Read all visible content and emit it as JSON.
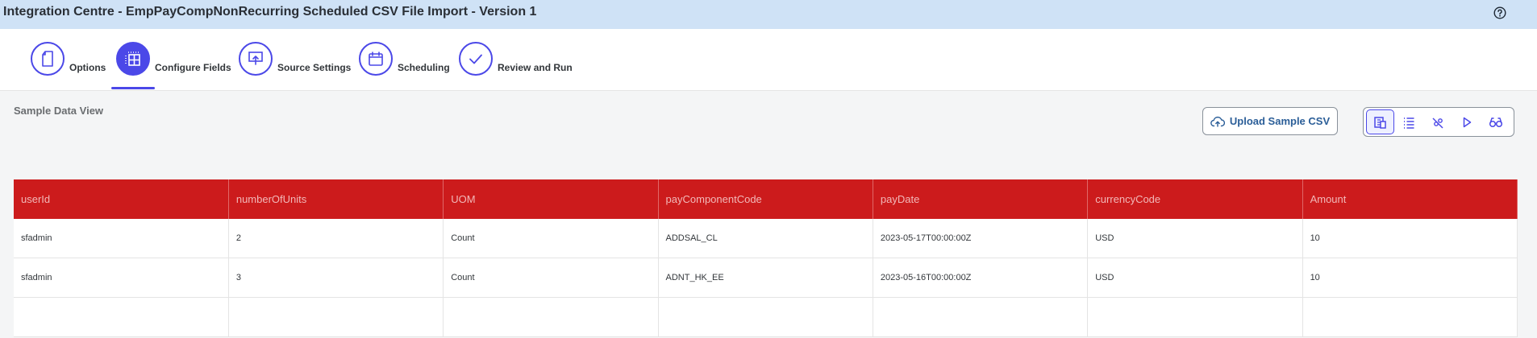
{
  "window": {
    "title": "Integration Centre - EmpPayCompNonRecurring Scheduled CSV File Import - Version 1",
    "help_icon": "question-circle-icon"
  },
  "wizard": {
    "steps": [
      {
        "label": "Options",
        "icon": "document-icon",
        "active": false
      },
      {
        "label": "Configure Fields",
        "icon": "table-fields-icon",
        "active": true
      },
      {
        "label": "Source Settings",
        "icon": "upload-presentation-icon",
        "active": false
      },
      {
        "label": "Scheduling",
        "icon": "calendar-icon",
        "active": false
      },
      {
        "label": "Review and Run",
        "icon": "checkmark-icon",
        "active": false
      }
    ]
  },
  "main": {
    "section_title": "Sample Data View",
    "upload_button_label": "Upload Sample CSV",
    "view_toolbar": [
      {
        "icon": "sample-data-view-icon",
        "active": true
      },
      {
        "icon": "list-view-icon",
        "active": false
      },
      {
        "icon": "mapping-view-icon",
        "active": false
      },
      {
        "icon": "play-icon",
        "active": false
      },
      {
        "icon": "preview-glasses-icon",
        "active": false
      }
    ]
  },
  "table": {
    "columns": [
      "userId",
      "numberOfUnits",
      "UOM",
      "payComponentCode",
      "payDate",
      "currencyCode",
      "Amount"
    ],
    "rows": [
      [
        "sfadmin",
        "2",
        "Count",
        "ADDSAL_CL",
        "2023-05-17T00:00:00Z",
        "USD",
        "10"
      ],
      [
        "sfadmin",
        "3",
        "Count",
        "ADNT_HK_EE",
        "2023-05-16T00:00:00Z",
        "USD",
        "10"
      ],
      [
        "",
        "",
        "",
        "",
        "",
        "",
        ""
      ]
    ]
  },
  "colors": {
    "accent": "#4b48e8",
    "header_bar": "#cfe2f6",
    "table_header": "#cc1b1c",
    "content_bg": "#f4f5f6"
  }
}
